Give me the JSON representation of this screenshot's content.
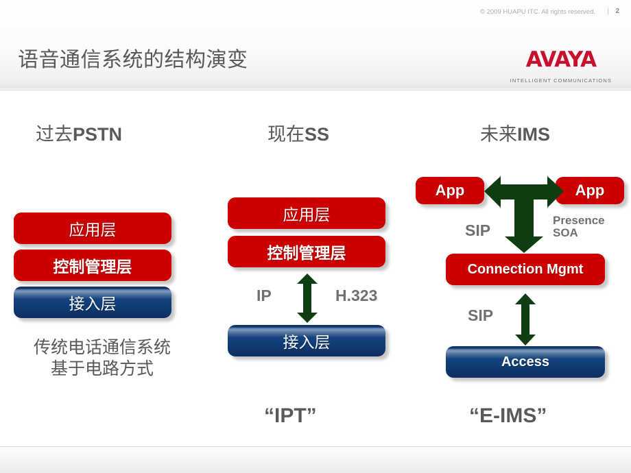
{
  "header": {
    "title": "语音通信系统的结构演变",
    "logo": {
      "mark": "AVAYA",
      "tagline": "INTELLIGENT COMMUNICATIONS"
    }
  },
  "columns": [
    {
      "heading_cn": "过去",
      "heading_latin": "PSTN",
      "boxes": [
        {
          "label": "应用层",
          "color": "red"
        },
        {
          "label": "控制管理层",
          "color": "red"
        },
        {
          "label": "接入层",
          "color": "blue"
        }
      ],
      "caption_line1": "传统电话通信系统",
      "caption_line2": "基于电路方式"
    },
    {
      "heading_cn": "现在",
      "heading_latin": "SS",
      "boxes": [
        {
          "label": "应用层",
          "color": "red"
        },
        {
          "label": "控制管理层",
          "color": "red"
        },
        {
          "label": "接入层",
          "color": "blue"
        }
      ],
      "arrow_label_left": "IP",
      "arrow_label_right": "H.323",
      "footer_quote": "“IPT”"
    },
    {
      "heading_cn": "未来",
      "heading_latin": "IMS",
      "boxes": [
        {
          "label": "App",
          "color": "red"
        },
        {
          "label": "App",
          "color": "red"
        },
        {
          "label": "Connection Mgmt",
          "color": "red"
        },
        {
          "label": "Access",
          "color": "blue"
        }
      ],
      "arrow_label_sip_top": "SIP",
      "arrow_label_presence_line1": "Presence",
      "arrow_label_presence_line2": "SOA",
      "arrow_label_sip_bottom": "SIP",
      "footer_quote": "“E-IMS”"
    }
  ],
  "footer": {
    "copyright": "© 2009 HUAPU ITC. All rights reserved.",
    "separator": "|",
    "page_number": "2"
  },
  "colors": {
    "brand_red": "#c8102e",
    "box_red": "#cc0000",
    "box_blue": "#10346b",
    "arrow_green": "#0d3d11",
    "text_gray": "#595959"
  }
}
